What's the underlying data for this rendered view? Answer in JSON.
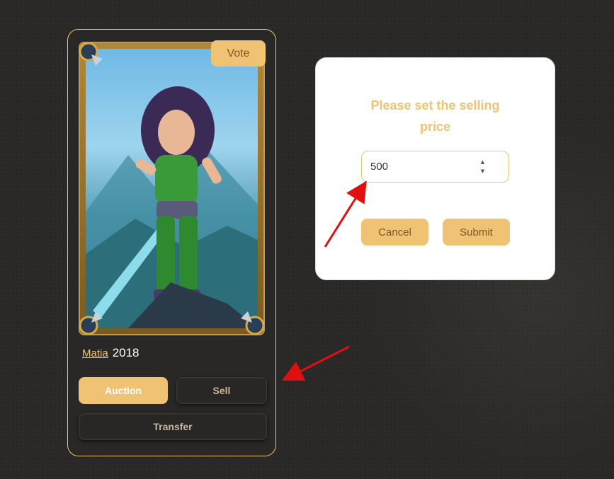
{
  "card": {
    "vote_label": "Vote",
    "name_link": "Matia",
    "year": "2018",
    "buttons": {
      "auction": "Auction",
      "sell": "Sell",
      "transfer": "Transfer"
    }
  },
  "dialog": {
    "title": "Please set the selling price",
    "price_value": "500",
    "cancel_label": "Cancel",
    "submit_label": "Submit"
  },
  "colors": {
    "accent": "#f0c374",
    "background": "#2a2826",
    "annotation_arrow": "#e01010"
  },
  "icons": {
    "stepper_up": "triangle-up-icon",
    "stepper_down": "triangle-down-icon"
  }
}
